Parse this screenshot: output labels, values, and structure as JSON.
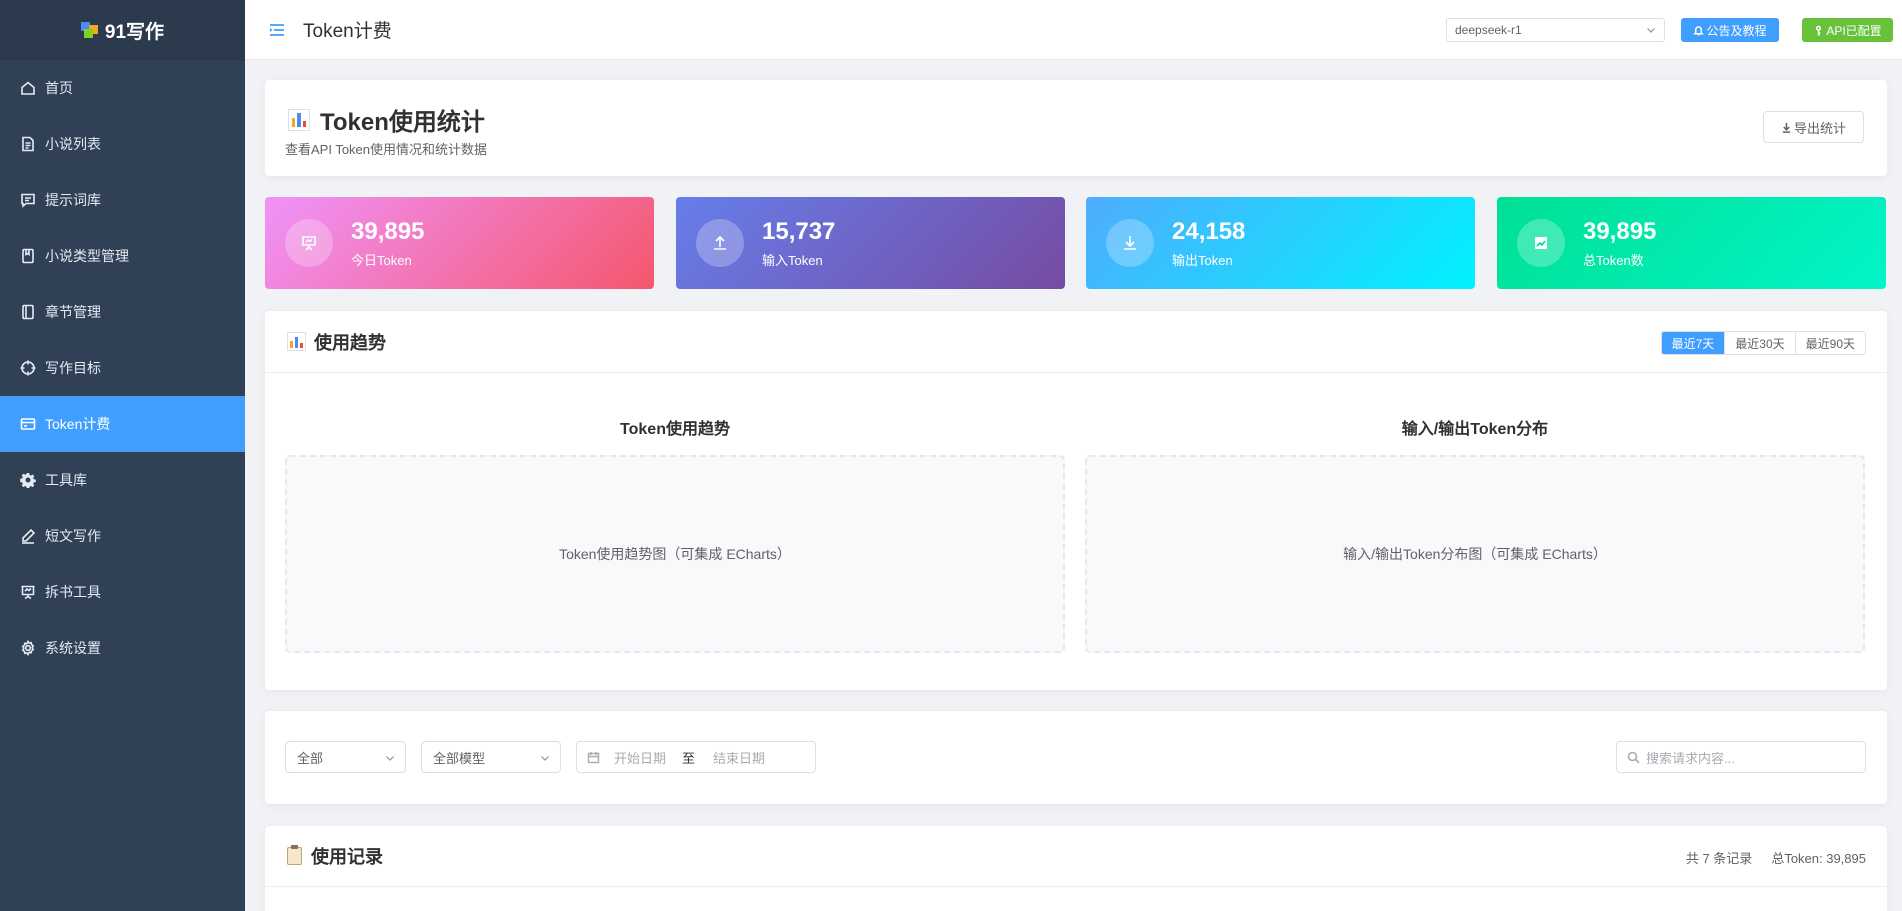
{
  "app": {
    "name": "91写作"
  },
  "sidebar": {
    "items": [
      {
        "label": "首页",
        "icon": "home-icon"
      },
      {
        "label": "小说列表",
        "icon": "document-icon"
      },
      {
        "label": "提示词库",
        "icon": "chat-icon"
      },
      {
        "label": "小说类型管理",
        "icon": "notebook-icon"
      },
      {
        "label": "章节管理",
        "icon": "book-icon"
      },
      {
        "label": "写作目标",
        "icon": "target-icon"
      },
      {
        "label": "Token计费",
        "icon": "credit-card-icon",
        "active": true
      },
      {
        "label": "工具库",
        "icon": "gear-icon"
      },
      {
        "label": "短文写作",
        "icon": "pen-icon"
      },
      {
        "label": "拆书工具",
        "icon": "presentation-icon"
      },
      {
        "label": "系统设置",
        "icon": "settings-icon"
      }
    ]
  },
  "topbar": {
    "title": "Token计费",
    "model": "deepseek-r1",
    "notice_button": "公告及教程",
    "api_button": "API已配置"
  },
  "header": {
    "title": "Token使用统计",
    "subtitle": "查看API Token使用情况和统计数据",
    "export_button": "导出统计"
  },
  "stats": [
    {
      "value": "39,895",
      "label": "今日Token",
      "icon": "presentation-icon"
    },
    {
      "value": "15,737",
      "label": "输入Token",
      "icon": "upload-icon"
    },
    {
      "value": "24,158",
      "label": "输出Token",
      "icon": "download-icon"
    },
    {
      "value": "39,895",
      "label": "总Token数",
      "icon": "trend-icon"
    }
  ],
  "trend": {
    "title": "使用趋势",
    "ranges": [
      "最近7天",
      "最近30天",
      "最近90天"
    ],
    "active_range": "最近7天",
    "left_chart_title": "Token使用趋势",
    "left_placeholder": "Token使用趋势图（可集成 ECharts）",
    "right_chart_title": "输入/输出Token分布",
    "right_placeholder": "输入/输出Token分布图（可集成 ECharts）"
  },
  "filters": {
    "type_value": "全部",
    "model_value": "全部模型",
    "start_placeholder": "开始日期",
    "range_separator": "至",
    "end_placeholder": "结束日期",
    "search_placeholder": "搜索请求内容..."
  },
  "records": {
    "title": "使用记录",
    "count_text": "共 7 条记录",
    "total_text": "总Token: 39,895"
  },
  "colors": {
    "sidebar_bg": "#304156",
    "active": "#409eff",
    "success": "#67c23a"
  }
}
